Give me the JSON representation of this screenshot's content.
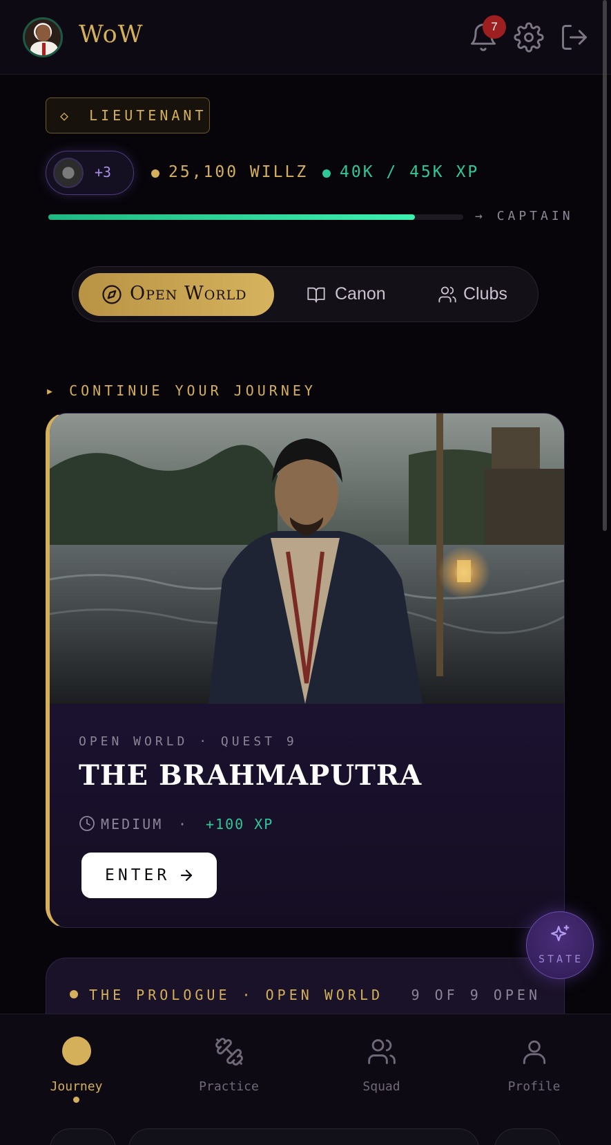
{
  "header": {
    "brand": "WoW",
    "notifications_count": "7",
    "icons": [
      "bell-icon",
      "gear-icon",
      "logout-icon"
    ]
  },
  "rank": {
    "label": "LIEUTENANT",
    "diamond": "◇"
  },
  "stats": {
    "companions_extra": "+3",
    "willz": "25,100 WILLZ",
    "xp": "40K / 45K XP",
    "xp_progress": 0.883,
    "next_rank": "→ CAPTAIN"
  },
  "segmented": {
    "items": [
      {
        "label": "Open World",
        "icon": "compass-icon",
        "active": true
      },
      {
        "label": "Canon",
        "icon": "book-icon",
        "active": false
      },
      {
        "label": "Clubs",
        "icon": "users-icon",
        "active": false
      }
    ]
  },
  "section": {
    "title": "▸ CONTINUE YOUR JOURNEY"
  },
  "quest": {
    "kicker": "OPEN WORLD · QUEST 9",
    "title": "THE BRAHMAPUTRA",
    "difficulty": "MEDIUM",
    "separator": "·",
    "reward": "+100 XP",
    "cta": "ENTER"
  },
  "prologue": {
    "title": "THE PROLOGUE · OPEN WORLD",
    "count": "9 OF 9 OPEN"
  },
  "fab": {
    "label": "STATE"
  },
  "bottom_nav": {
    "items": [
      {
        "label": "Journey",
        "icon": "journey-icon",
        "active": true
      },
      {
        "label": "Practice",
        "icon": "dumbbell-icon",
        "active": false
      },
      {
        "label": "Squad",
        "icon": "squad-icon",
        "active": false
      },
      {
        "label": "Profile",
        "icon": "profile-icon",
        "active": false
      }
    ]
  },
  "colors": {
    "gold": "#d4b05a",
    "xp_green": "#2ec99a",
    "purple": "#9d86d6",
    "badge_red": "#9e1f1f"
  }
}
